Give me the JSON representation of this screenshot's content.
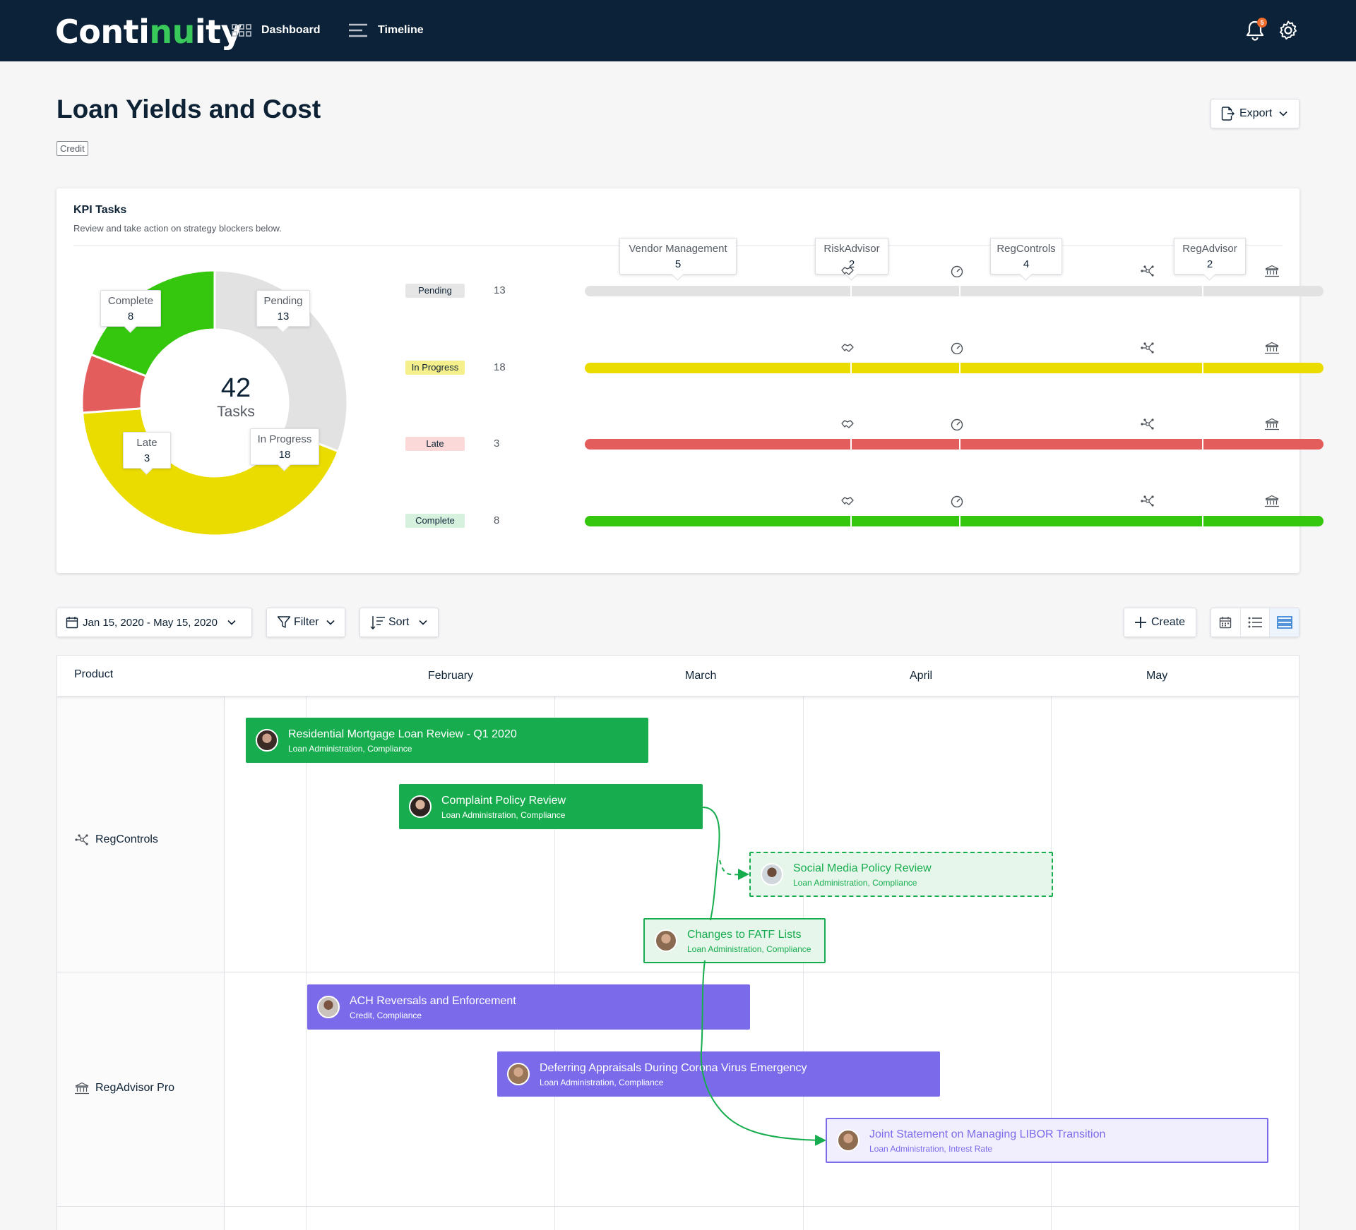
{
  "app": {
    "logo": {
      "prefix": "Conti",
      "accent": "nu",
      "suffix": "ity"
    },
    "nav": [
      {
        "label": "Dashboard"
      },
      {
        "label": "Timeline"
      }
    ],
    "notifications": {
      "count": "5"
    }
  },
  "page": {
    "title": "Loan Yields and Cost",
    "tag": "Credit",
    "export_label": "Export"
  },
  "kpi": {
    "title": "KPI Tasks",
    "subtitle": "Review and take action on strategy blockers below.",
    "total": "42",
    "total_label": "Tasks",
    "segments": [
      {
        "label": "Complete",
        "value": "8",
        "color": "#34c70d"
      },
      {
        "label": "Pending",
        "value": "13",
        "color": "#e2e2e2"
      },
      {
        "label": "In Progress",
        "value": "18",
        "color": "#ebdc00"
      },
      {
        "label": "Late",
        "value": "3",
        "color": "#e35d5d"
      }
    ],
    "products": [
      {
        "name": "Vendor Management",
        "value": "5",
        "icon": "handshake-icon"
      },
      {
        "name": "RiskAdvisor",
        "value": "2",
        "icon": "gauge-icon"
      },
      {
        "name": "RegControls",
        "value": "4",
        "icon": "network-icon"
      },
      {
        "name": "RegAdvisor",
        "value": "2",
        "icon": "bank-icon"
      }
    ],
    "statuses": [
      {
        "label": "Pending",
        "count": "13",
        "tag_bg": "#e6e6e6",
        "bar_color": "#e2e2e2"
      },
      {
        "label": "In Progress",
        "count": "18",
        "tag_bg": "#f5ef8c",
        "bar_color": "#ebdc00"
      },
      {
        "label": "Late",
        "count": "3",
        "tag_bg": "#fbd9d9",
        "bar_color": "#e35d5d"
      },
      {
        "label": "Complete",
        "count": "8",
        "tag_bg": "#d6f1dd",
        "bar_color": "#34c70d"
      }
    ]
  },
  "toolbar": {
    "date_range": "Jan 15, 2020 - May 15, 2020",
    "filter_label": "Filter",
    "sort_label": "Sort",
    "create_label": "Create"
  },
  "timeline": {
    "product_header": "Product",
    "months": [
      "February",
      "March",
      "April",
      "May"
    ],
    "rows": [
      {
        "label": "RegControls"
      },
      {
        "label": "RegAdvisor Pro"
      }
    ],
    "tasks": [
      {
        "title": "Residential Mortgage Loan Review - Q1 2020",
        "tags": "Loan Administration, Compliance"
      },
      {
        "title": "Complaint Policy Review",
        "tags": "Loan Administration, Compliance"
      },
      {
        "title": "Social Media Policy Review",
        "tags": "Loan Administration, Compliance"
      },
      {
        "title": "Changes to FATF Lists",
        "tags": "Loan Administration, Compliance"
      },
      {
        "title": "ACH Reversals and Enforcement",
        "tags": "Credit, Compliance"
      },
      {
        "title": "Deferring Appraisals During Corona Virus Emergency",
        "tags": "Loan Administration, Compliance"
      },
      {
        "title": "Joint Statement on Managing LIBOR Transition",
        "tags": "Loan Administration, Intrest Rate"
      }
    ]
  }
}
